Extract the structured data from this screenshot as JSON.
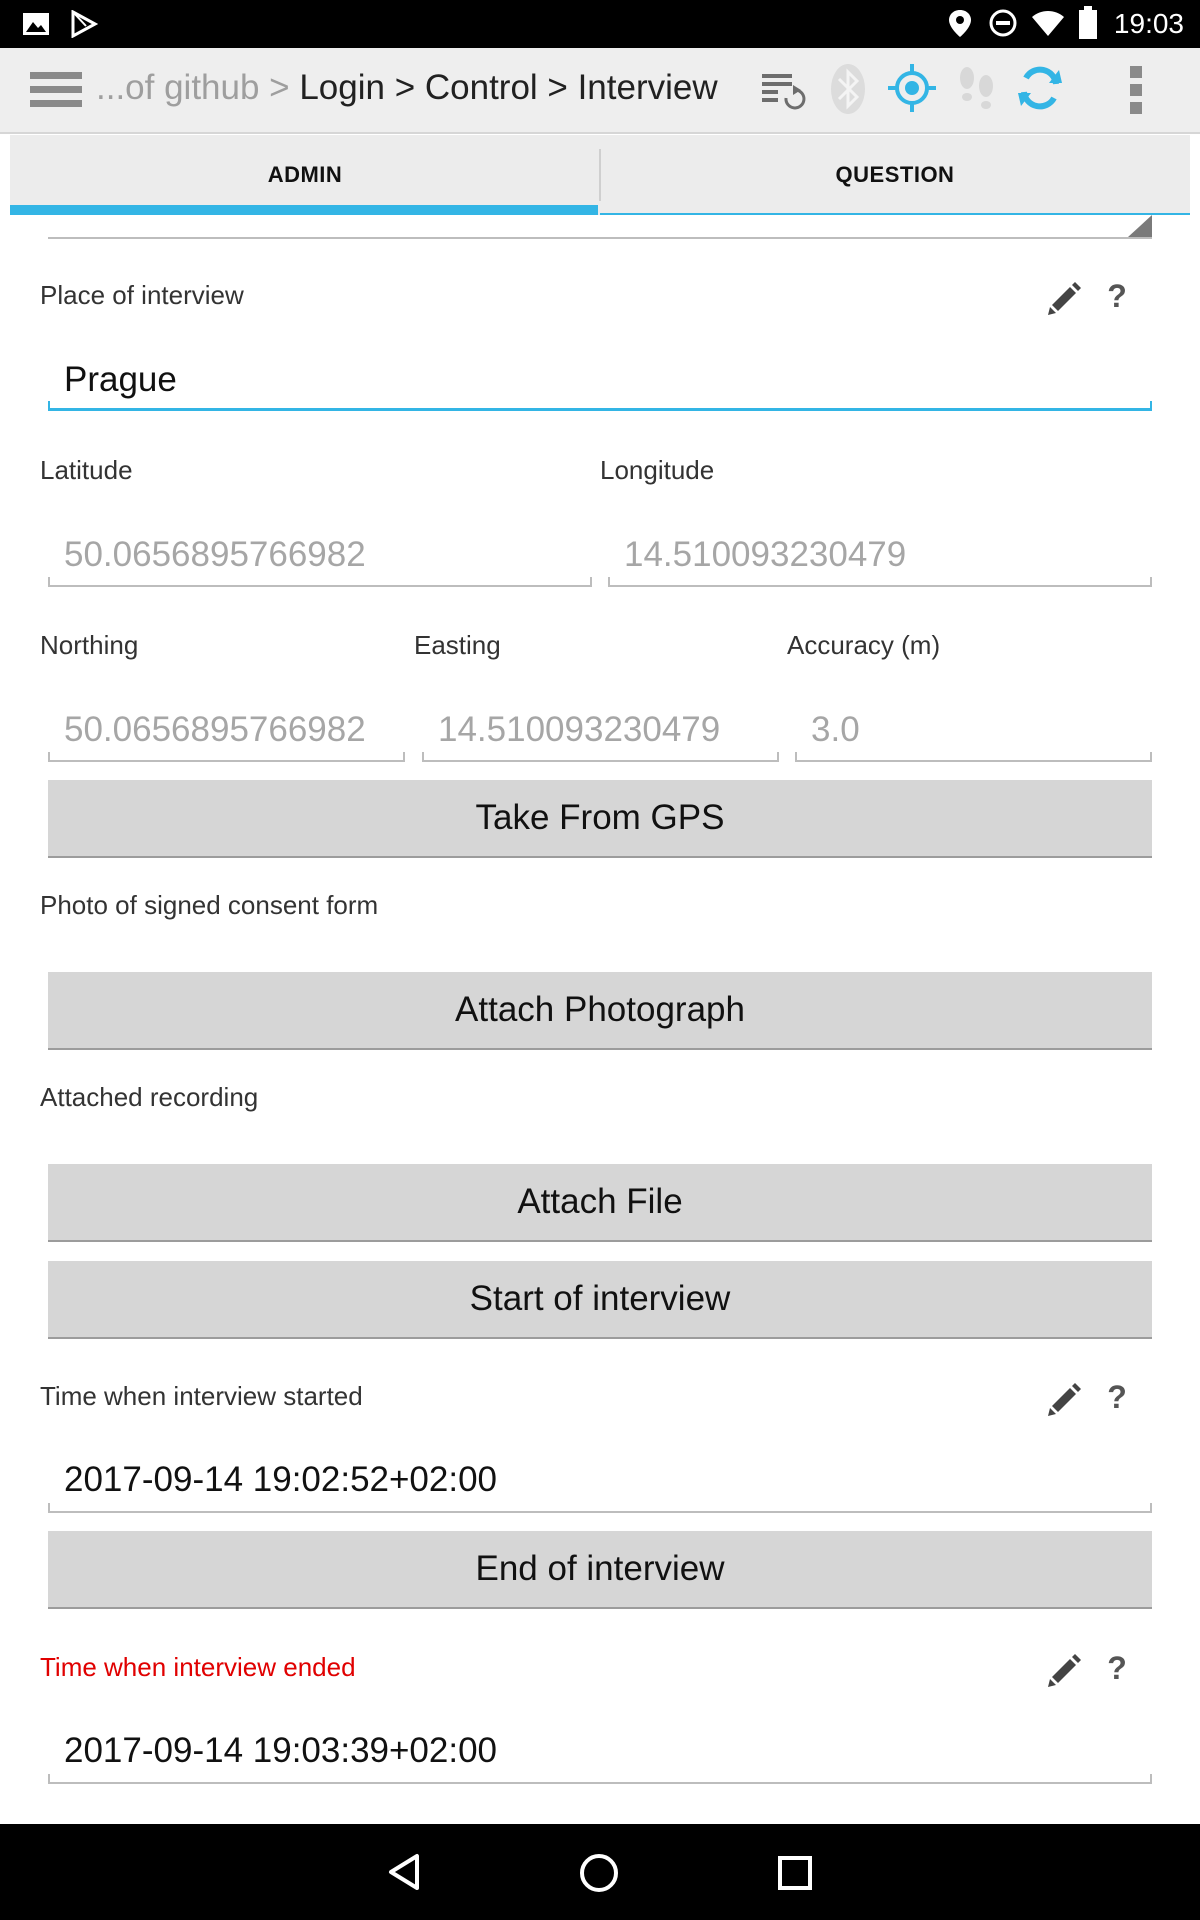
{
  "status_bar": {
    "time": "19:03",
    "left_icons": [
      "gallery-icon",
      "play-store-icon"
    ],
    "right_icons": [
      "location-icon",
      "do-not-disturb-icon",
      "wifi-icon",
      "battery-icon"
    ]
  },
  "toolbar": {
    "breadcrumb_prefix": "...of github > ",
    "breadcrumb_path": "Login > Control > Interview",
    "icons": [
      "menu-icon",
      "sync-records-icon",
      "bluetooth-icon",
      "gps-icon",
      "footsteps-icon",
      "refresh-icon",
      "overflow-menu-icon"
    ],
    "accent_color": "#33b5e5"
  },
  "tabs": [
    {
      "label": "ADMIN",
      "selected": true
    },
    {
      "label": "QUESTION",
      "selected": false
    }
  ],
  "form": {
    "place_label": "Place of interview",
    "place_value": "Prague",
    "latitude_label": "Latitude",
    "latitude_value": "50.0656895766982",
    "longitude_label": "Longitude",
    "longitude_value": "14.510093230479",
    "northing_label": "Northing",
    "northing_value": "50.0656895766982",
    "easting_label": "Easting",
    "easting_value": "14.510093230479",
    "accuracy_label": "Accuracy (m)",
    "accuracy_value": "3.0",
    "gps_button": "Take From GPS",
    "photo_label": "Photo of signed consent form",
    "photo_button": "Attach Photograph",
    "recording_label": "Attached recording",
    "file_button": "Attach File",
    "start_button": "Start of interview",
    "start_time_label": "Time when interview started",
    "start_time_value": "2017-09-14 19:02:52+02:00",
    "end_button": "End of interview",
    "end_time_label": "Time when interview ended",
    "end_time_value": "2017-09-14 19:03:39+02:00",
    "help_glyph": "?",
    "error_color": "#e00000"
  }
}
